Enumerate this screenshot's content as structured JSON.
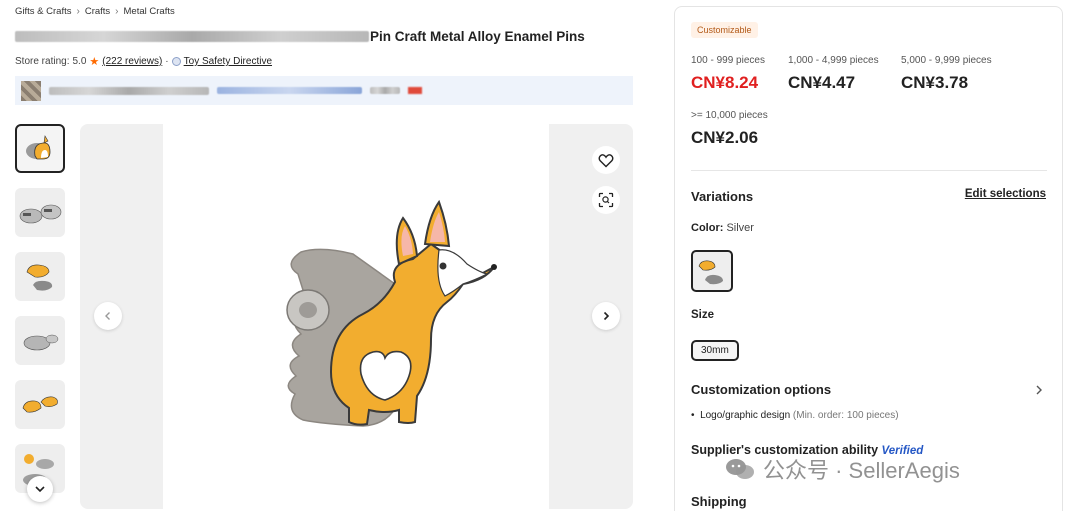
{
  "breadcrumb": [
    "Gifts & Crafts",
    "Crafts",
    "Metal Crafts"
  ],
  "product": {
    "title_visible": "Pin Craft Metal Alloy Enamel Pins",
    "store_rating_label": "Store rating:",
    "store_rating_value": "5.0",
    "reviews": "(222 reviews)",
    "separator": "·",
    "badge_text": "Toy Safety Directive"
  },
  "gallery": {
    "thumbnail_count": 6
  },
  "panel": {
    "tag": "Customizable",
    "tiers": [
      {
        "qty": "100 - 999 pieces",
        "price": "CN¥8.24"
      },
      {
        "qty": "1,000 - 4,999 pieces",
        "price": "CN¥4.47"
      },
      {
        "qty": "5,000 - 9,999 pieces",
        "price": "CN¥3.78"
      },
      {
        "qty": ">= 10,000 pieces",
        "price": "CN¥2.06"
      }
    ],
    "variations_title": "Variations",
    "edit_selections": "Edit selections",
    "color_label": "Color:",
    "color_value": "Silver",
    "size_title": "Size",
    "size_value": "30mm",
    "customization_title": "Customization options",
    "customization_item": "Logo/graphic design",
    "customization_note": "(Min. order: 100 pieces)",
    "ability_title": "Supplier's customization ability",
    "ability_badge": "Verified",
    "shipping_title": "Shipping"
  },
  "watermark": "公众号 · SellerAegis",
  "colors": {
    "price_red": "#e02020",
    "tag_bg": "#fff1e6",
    "tag_text": "#b35a18",
    "verified_blue": "#2457c5",
    "star_orange": "#ff6a00",
    "corgi_orange": "#f2ad2f"
  }
}
